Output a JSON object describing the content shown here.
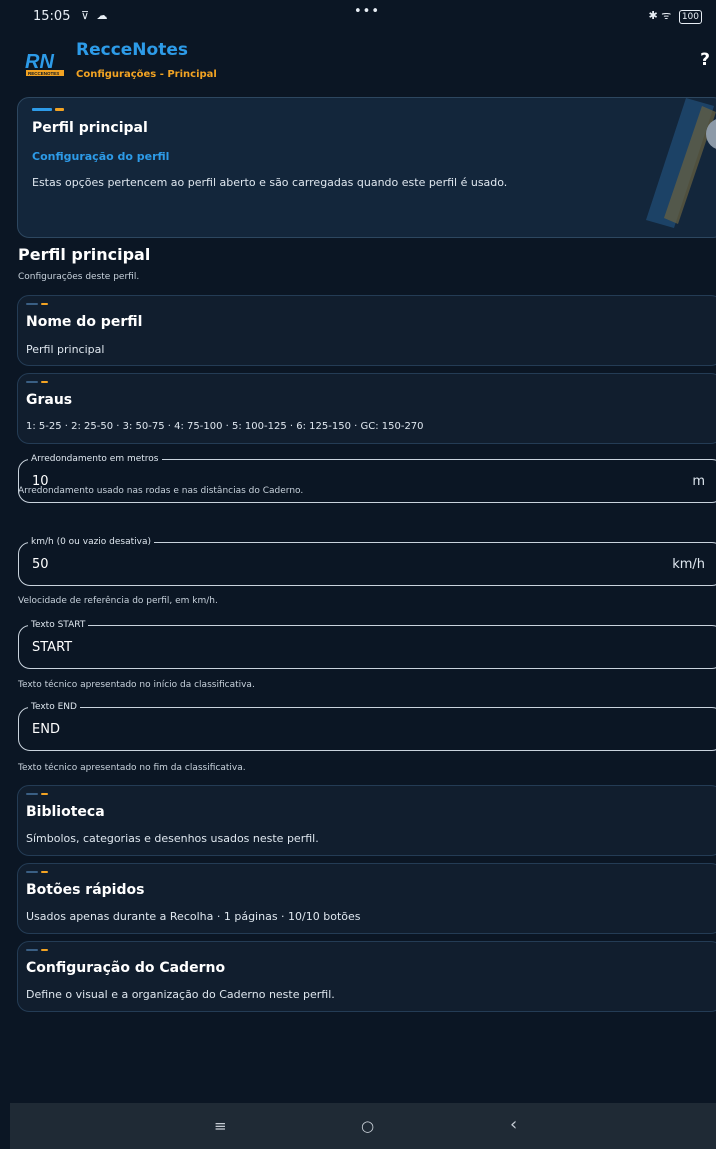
{
  "status_bar": {
    "time": "15:05",
    "left_icons": "⊽ ☁",
    "dots": "•••",
    "right_icons": "✱ ᯤ",
    "battery": "100"
  },
  "header": {
    "app_title": "RecceNotes",
    "subtitle": "Configurações - Principal",
    "logo_text": "RN",
    "logo_caption": "RECCENOTES",
    "help": "?"
  },
  "hero": {
    "title": "Perfil principal",
    "subtitle": "Configuração do perfil",
    "description": "Estas opções pertencem ao perfil aberto e são carregadas quando este perfil é usado."
  },
  "section": {
    "title": "Perfil principal",
    "description": "Configurações deste perfil."
  },
  "cards": {
    "profile_name": {
      "title": "Nome do perfil",
      "value": "Perfil principal"
    },
    "grades": {
      "title": "Graus",
      "value": "1: 5-25 · 2: 25-50 · 3: 50-75 · 4: 75-100 · 5: 100-125 · 6: 125-150 · GC: 150-270"
    },
    "library": {
      "title": "Biblioteca",
      "value": "Símbolos, categorias e desenhos usados neste perfil."
    },
    "quick_buttons": {
      "title": "Botões rápidos",
      "value": "Usados apenas durante a Recolha · 1 páginas · 10/10 botões"
    },
    "notebook": {
      "title": "Configuração do Caderno",
      "value": "Define o visual e a organização do Caderno neste perfil."
    }
  },
  "fields": {
    "rounding": {
      "label": "Arredondamento em metros",
      "value": "10",
      "suffix": "m",
      "helper": "Arredondamento usado nas rodas e nas distâncias do Caderno."
    },
    "speed": {
      "label": "km/h (0 ou vazio desativa)",
      "value": "50",
      "suffix": "km/h",
      "helper": "Velocidade de referência do perfil, em km/h."
    },
    "start_text": {
      "label": "Texto START",
      "value": "START",
      "helper": "Texto técnico apresentado no início da classificativa."
    },
    "end_text": {
      "label": "Texto END",
      "value": "END",
      "helper": "Texto técnico apresentado no fim da classificativa."
    }
  },
  "nav": {
    "menu": "≡",
    "home": "○",
    "back": "‹"
  },
  "colors": {
    "background": "#0b1624",
    "accent_blue": "#2d9be8",
    "accent_orange": "#f2a323",
    "card": "#111e2e"
  }
}
